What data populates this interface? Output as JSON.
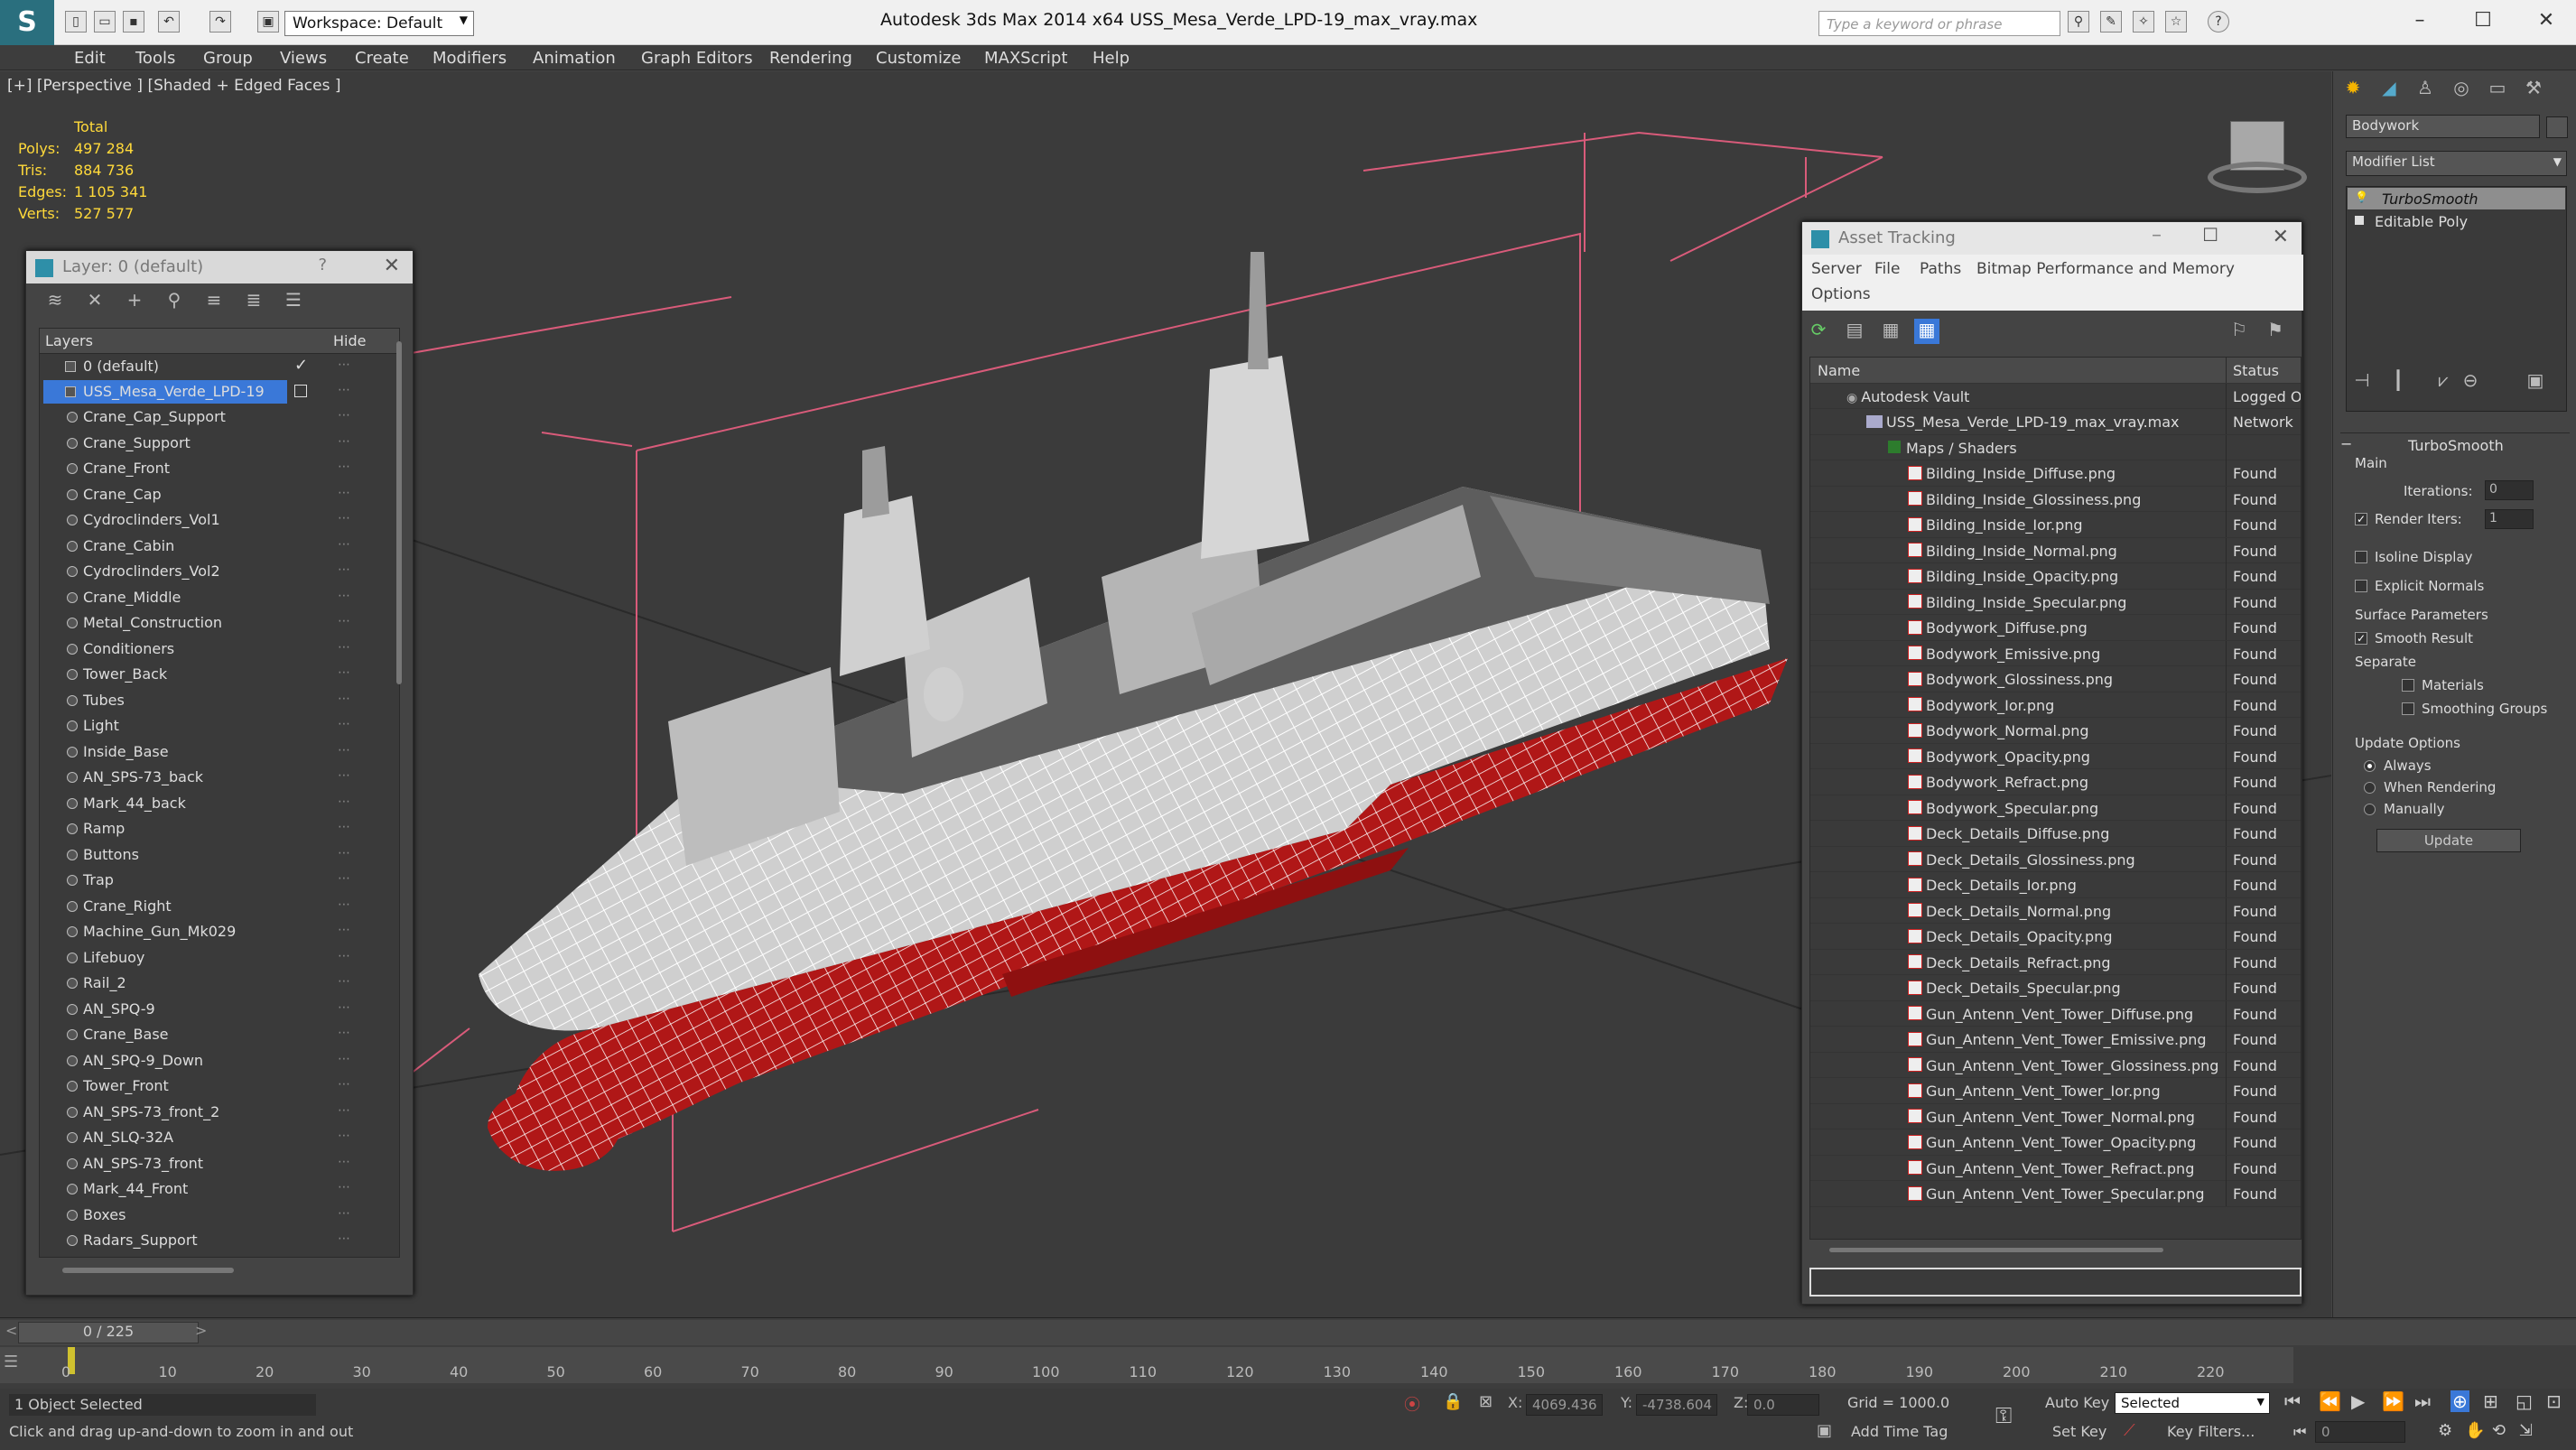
{
  "app": {
    "title": "Autodesk 3ds Max  2014 x64     USS_Mesa_Verde_LPD-19_max_vray.max",
    "workspace": "Workspace: Default",
    "search_placeholder": "Type a keyword or phrase"
  },
  "menu": [
    "Edit",
    "Tools",
    "Group",
    "Views",
    "Create",
    "Modifiers",
    "Animation",
    "Graph Editors",
    "Rendering",
    "Customize",
    "MAXScript",
    "Help"
  ],
  "viewport": {
    "label": "[+] [Perspective ] [Shaded + Edged Faces ]",
    "stats": {
      "total_label": "Total",
      "rows": [
        {
          "k": "Polys:",
          "v": "497 284"
        },
        {
          "k": "Tris:",
          "v": "884 736"
        },
        {
          "k": "Edges:",
          "v": "1 105 341"
        },
        {
          "k": "Verts:",
          "v": "527 577"
        }
      ]
    }
  },
  "layers_panel": {
    "title": "Layer: 0 (default)",
    "help": "?",
    "col_layers": "Layers",
    "col_hide": "Hide",
    "default_layer": "0 (default)",
    "selected_layer": "USS_Mesa_Verde_LPD-19",
    "objects": [
      "Crane_Cap_Support",
      "Crane_Support",
      "Crane_Front",
      "Crane_Cap",
      "Cydroclinders_Vol1",
      "Crane_Cabin",
      "Cydroclinders_Vol2",
      "Crane_Middle",
      "Metal_Construction",
      "Conditioners",
      "Tower_Back",
      "Tubes",
      "Light",
      "Inside_Base",
      "AN_SPS-73_back",
      "Mark_44_back",
      "Ramp",
      "Buttons",
      "Trap",
      "Crane_Right",
      "Machine_Gun_Mk029",
      "Lifebuoy",
      "Rail_2",
      "AN_SPQ-9",
      "Crane_Base",
      "AN_SPQ-9_Down",
      "Tower_Front",
      "AN_SPS-73_front_2",
      "AN_SLQ-32A",
      "AN_SPS-73_front",
      "Mark_44_Front",
      "Boxes",
      "Radars_Support"
    ]
  },
  "asset_panel": {
    "title": "Asset Tracking",
    "menu": [
      "Server",
      "File",
      "Paths",
      "Bitmap Performance and Memory",
      "Options"
    ],
    "col_name": "Name",
    "col_status": "Status",
    "vault": {
      "name": "Autodesk Vault",
      "status": "Logged Out"
    },
    "file": {
      "name": "USS_Mesa_Verde_LPD-19_max_vray.max",
      "status": "Network"
    },
    "folder": "Maps / Shaders",
    "maps": [
      "Bilding_Inside_Diffuse.png",
      "Bilding_Inside_Glossiness.png",
      "Bilding_Inside_Ior.png",
      "Bilding_Inside_Normal.png",
      "Bilding_Inside_Opacity.png",
      "Bilding_Inside_Specular.png",
      "Bodywork_Diffuse.png",
      "Bodywork_Emissive.png",
      "Bodywork_Glossiness.png",
      "Bodywork_Ior.png",
      "Bodywork_Normal.png",
      "Bodywork_Opacity.png",
      "Bodywork_Refract.png",
      "Bodywork_Specular.png",
      "Deck_Details_Diffuse.png",
      "Deck_Details_Glossiness.png",
      "Deck_Details_Ior.png",
      "Deck_Details_Normal.png",
      "Deck_Details_Opacity.png",
      "Deck_Details_Refract.png",
      "Deck_Details_Specular.png",
      "Gun_Antenn_Vent_Tower_Diffuse.png",
      "Gun_Antenn_Vent_Tower_Emissive.png",
      "Gun_Antenn_Vent_Tower_Glossiness.png",
      "Gun_Antenn_Vent_Tower_Ior.png",
      "Gun_Antenn_Vent_Tower_Normal.png",
      "Gun_Antenn_Vent_Tower_Opacity.png",
      "Gun_Antenn_Vent_Tower_Refract.png",
      "Gun_Antenn_Vent_Tower_Specular.png"
    ],
    "map_status": "Found"
  },
  "command_panel": {
    "object_name": "Bodywork",
    "modifier_list": "Modifier List",
    "stack": [
      "TurboSmooth",
      "Editable Poly"
    ],
    "rollout": "TurboSmooth",
    "main": "Main",
    "iterations_label": "Iterations:",
    "iterations": "0",
    "render_iters_label": "Render Iters:",
    "render_iters": "1",
    "isoline": "Isoline Display",
    "explicit_normals": "Explicit Normals",
    "surface_params": "Surface Parameters",
    "smooth_result": "Smooth Result",
    "separate": "Separate",
    "materials": "Materials",
    "smoothing_groups": "Smoothing Groups",
    "update_options": "Update Options",
    "always": "Always",
    "when_rendering": "When Rendering",
    "manually": "Manually",
    "update_btn": "Update"
  },
  "timeline": {
    "frame": "0 / 225",
    "ticks": [
      "0",
      "10",
      "20",
      "30",
      "40",
      "50",
      "60",
      "70",
      "80",
      "90",
      "100",
      "110",
      "120",
      "130",
      "140",
      "150",
      "160",
      "170",
      "180",
      "190",
      "200",
      "210",
      "220"
    ],
    "status": "1 Object Selected",
    "prompt": "Click and drag up-and-down to zoom in and out",
    "x_label": "X:",
    "x": "4069.436",
    "y_label": "Y:",
    "y": "-4738.604",
    "z_label": "Z:",
    "z": "0.0",
    "grid": "Grid = 1000.0",
    "autokey": "Auto Key",
    "selected": "Selected",
    "setkey": "Set Key",
    "keyfilters": "Key Filters...",
    "addtimetag": "Add Time Tag",
    "current_frame": "0"
  }
}
